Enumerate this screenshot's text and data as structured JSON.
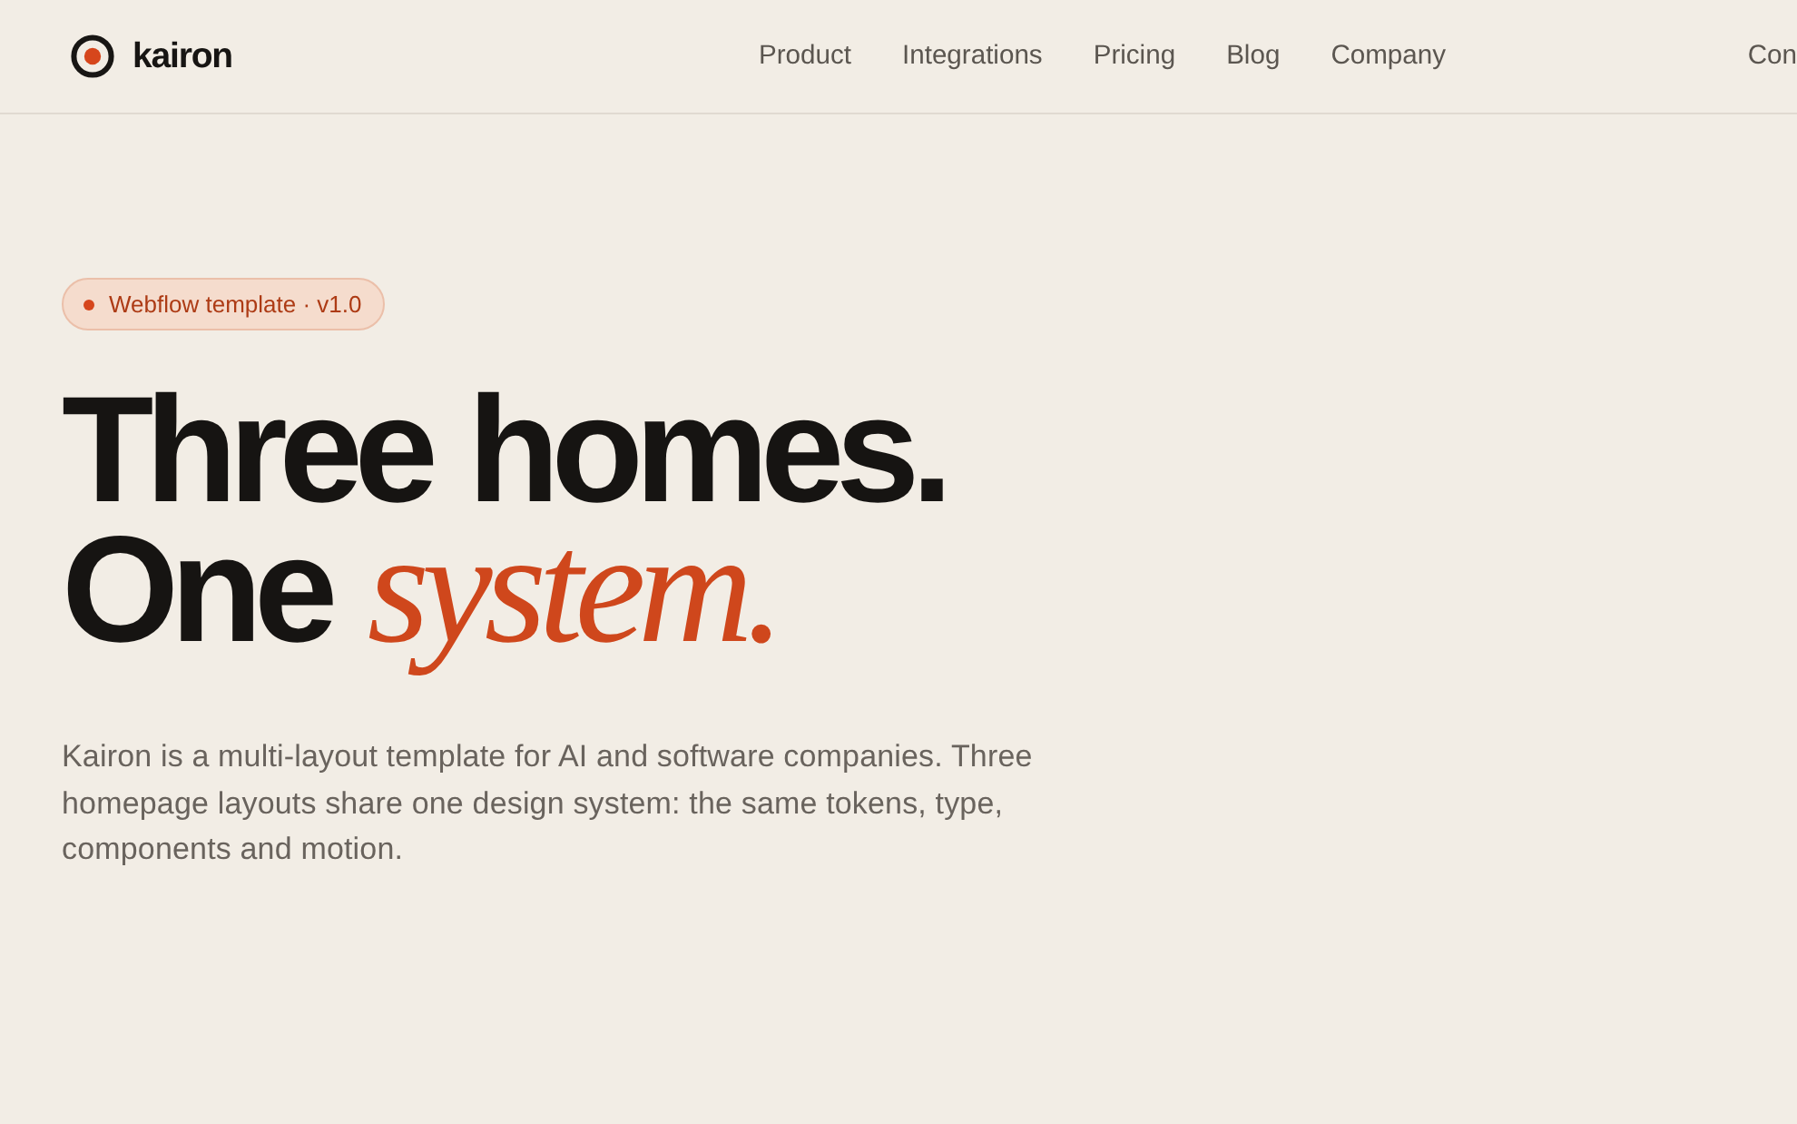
{
  "header": {
    "brand": "kairon",
    "nav": [
      "Product",
      "Integrations",
      "Pricing",
      "Blog",
      "Company"
    ],
    "right_link": "Con"
  },
  "hero": {
    "badge": "Webflow template · v1.0",
    "headline": "Three homes. One *system.*",
    "description": "Kairon is a multi-layout template for AI and software companies. Three homepage layouts share one design system: the same tokens, type, components and motion."
  }
}
